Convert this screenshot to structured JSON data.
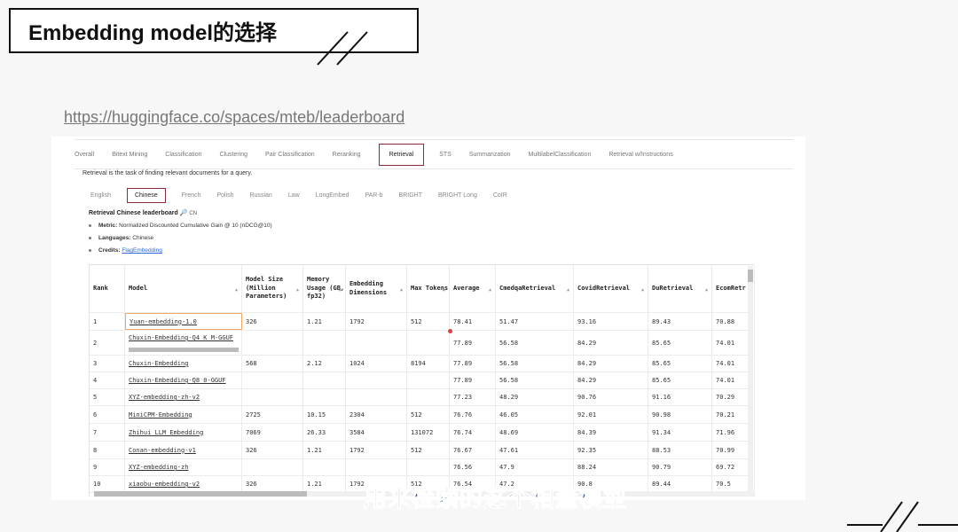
{
  "slide": {
    "title": "Embedding model的选择",
    "url": "https://huggingface.co/spaces/mteb/leaderboard",
    "subtitle": "用来检索的这个相量模型"
  },
  "tabs_top": [
    "Overall",
    "Bitext Mining",
    "Classification",
    "Clustering",
    "Pair Classification",
    "Reranking",
    "Retrieval",
    "STS",
    "Summarization",
    "MultilabelClassification",
    "Retrieval w/Instructions"
  ],
  "tabs_top_active": "Retrieval",
  "description": "Retrieval is the task of finding relevant documents for a query.",
  "tabs_lang": [
    "English",
    "Chinese",
    "French",
    "Polish",
    "Russian",
    "Law",
    "LongEmbed",
    "PAR-b",
    "BRIGHT",
    "BRIGHT Long",
    "CoIR"
  ],
  "tabs_lang_active": "Chinese",
  "leaderboard": {
    "title": "Retrieval Chinese leaderboard 🔎",
    "flag": "CN",
    "metric_label": "Metric:",
    "metric_value": "Normalized Discounted Cumulative Gain @ 10 (nDCG@10)",
    "languages_label": "Languages:",
    "languages_value": "Chinese",
    "credits_label": "Credits:",
    "credits_value": "FlagEmbedding"
  },
  "table": {
    "headers": [
      "Rank",
      "Model",
      "Model Size (Million Parameters)",
      "Memory Usage (GB, fp32)",
      "Embedding Dimensions",
      "Max Tokens",
      "Average",
      "CmedqaRetrieval",
      "CovidRetrieval",
      "DuRetrieval",
      "EcomRetr"
    ],
    "rows": [
      [
        "1",
        "Yuan-embedding-1.0",
        "326",
        "1.21",
        "1792",
        "512",
        "78.41",
        "51.47",
        "93.16",
        "89.43",
        "70.88"
      ],
      [
        "2",
        "Chuxin-Embedding-Q4_K_M-GGUF",
        "",
        "",
        "",
        "",
        "77.89",
        "56.58",
        "84.29",
        "85.65",
        "74.01"
      ],
      [
        "3",
        "Chuxin-Embedding",
        "568",
        "2.12",
        "1024",
        "8194",
        "77.89",
        "56.58",
        "84.29",
        "85.65",
        "74.01"
      ],
      [
        "4",
        "Chuxin-Embedding-Q8_0-GGUF",
        "",
        "",
        "",
        "",
        "77.89",
        "56.58",
        "84.29",
        "85.65",
        "74.01"
      ],
      [
        "5",
        "XYZ-embedding-zh-v2",
        "",
        "",
        "",
        "",
        "77.23",
        "48.29",
        "90.76",
        "91.16",
        "70.29"
      ],
      [
        "6",
        "MiniCPM-Embedding",
        "2725",
        "10.15",
        "2304",
        "512",
        "76.76",
        "46.05",
        "92.01",
        "90.98",
        "70.21"
      ],
      [
        "7",
        "Zhihui_LLM_Embedding",
        "7069",
        "26.33",
        "3584",
        "131072",
        "76.74",
        "48.69",
        "84.39",
        "91.34",
        "71.96"
      ],
      [
        "8",
        "Conan-embedding-v1",
        "326",
        "1.21",
        "1792",
        "512",
        "76.67",
        "47.61",
        "92.35",
        "88.53",
        "70.99"
      ],
      [
        "9",
        "XYZ-embedding-zh",
        "",
        "",
        "",
        "",
        "76.56",
        "47.9",
        "88.24",
        "90.79",
        "69.72"
      ],
      [
        "10",
        "xiaobu-embedding-v2",
        "326",
        "1.21",
        "1792",
        "512",
        "76.54",
        "47.2",
        "90.8",
        "89.44",
        "70.5"
      ]
    ]
  },
  "colors": {
    "accent": "#8b2b3b",
    "link": "#2d6ad8",
    "subtitle": "#1a3fa8"
  }
}
